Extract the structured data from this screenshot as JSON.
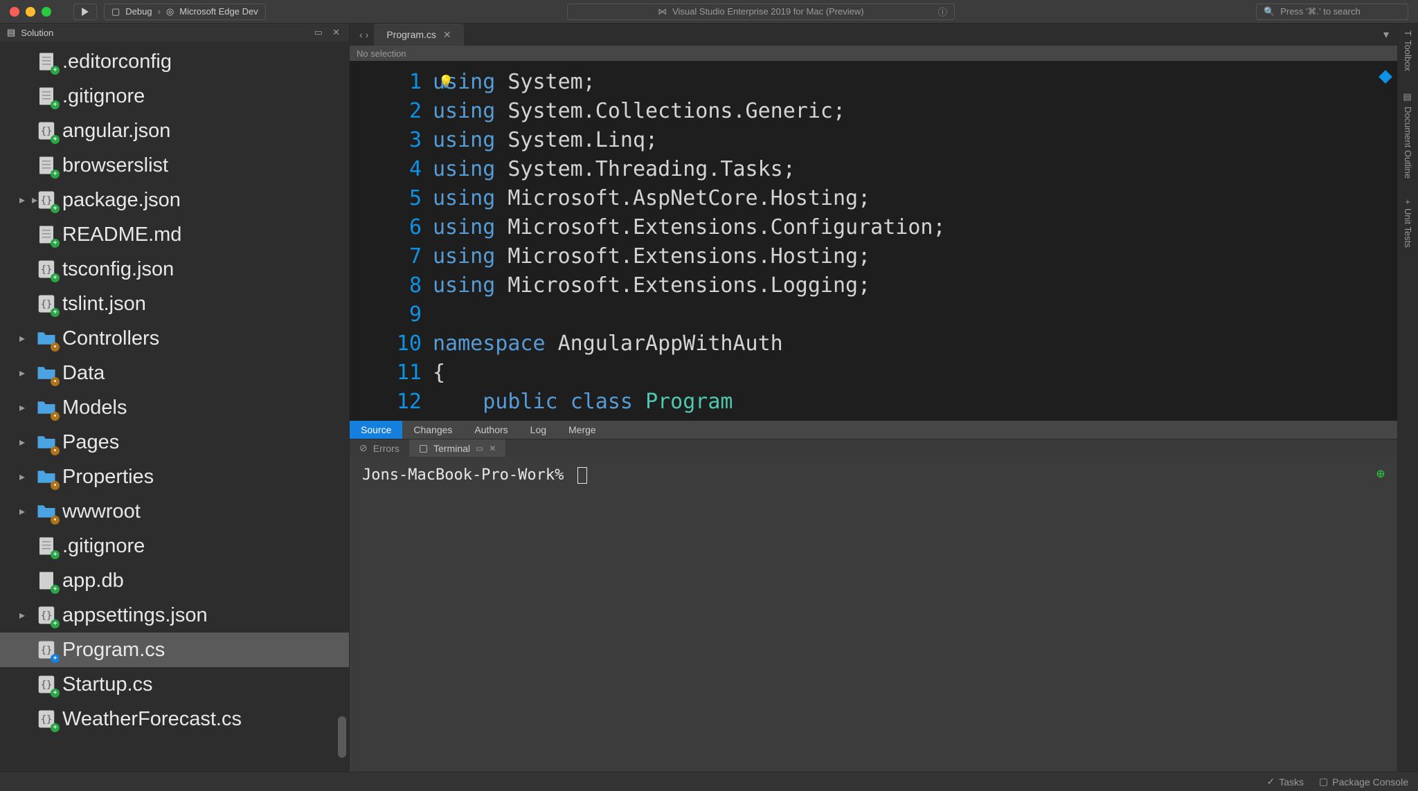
{
  "titlebar": {
    "debug_label": "Debug",
    "target_label": "Microsoft Edge Dev",
    "app_title": "Visual Studio Enterprise 2019 for Mac (Preview)",
    "search_placeholder": "Press '⌘.' to search"
  },
  "solution": {
    "header": "Solution",
    "items": [
      {
        "name": ".editorconfig",
        "icon": "file",
        "badge": "add",
        "expand": false
      },
      {
        "name": ".gitignore",
        "icon": "file",
        "badge": "add",
        "expand": false
      },
      {
        "name": "angular.json",
        "icon": "json",
        "badge": "add",
        "expand": false
      },
      {
        "name": "browserslist",
        "icon": "file",
        "badge": "add",
        "expand": false
      },
      {
        "name": "package.json",
        "icon": "json",
        "badge": "add",
        "expand": true,
        "extra_expand": true
      },
      {
        "name": "README.md",
        "icon": "file",
        "badge": "add",
        "expand": false
      },
      {
        "name": "tsconfig.json",
        "icon": "json",
        "badge": "add",
        "expand": false
      },
      {
        "name": "tslint.json",
        "icon": "json",
        "badge": "add",
        "expand": false
      },
      {
        "name": "Controllers",
        "icon": "folder",
        "badge": "mod",
        "expand": true
      },
      {
        "name": "Data",
        "icon": "folder",
        "badge": "mod",
        "expand": true
      },
      {
        "name": "Models",
        "icon": "folder",
        "badge": "mod",
        "expand": true
      },
      {
        "name": "Pages",
        "icon": "folder",
        "badge": "mod",
        "expand": true
      },
      {
        "name": "Properties",
        "icon": "folder",
        "badge": "mod",
        "expand": true
      },
      {
        "name": "wwwroot",
        "icon": "folder",
        "badge": "mod",
        "expand": true
      },
      {
        "name": ".gitignore",
        "icon": "file",
        "badge": "add",
        "expand": false
      },
      {
        "name": "app.db",
        "icon": "blank",
        "badge": "add",
        "expand": false
      },
      {
        "name": "appsettings.json",
        "icon": "json",
        "badge": "add",
        "expand": true
      },
      {
        "name": "Program.cs",
        "icon": "json",
        "badge": "addblue",
        "expand": false,
        "selected": true
      },
      {
        "name": "Startup.cs",
        "icon": "json",
        "badge": "add",
        "expand": false
      },
      {
        "name": "WeatherForecast.cs",
        "icon": "json",
        "badge": "add",
        "expand": false
      }
    ]
  },
  "editor": {
    "tab_name": "Program.cs",
    "breadcrumb": "No selection",
    "lines": [
      {
        "n": 1,
        "tokens": [
          [
            "kw",
            "using"
          ],
          [
            "ns",
            " System;"
          ]
        ]
      },
      {
        "n": 2,
        "tokens": [
          [
            "kw",
            "using"
          ],
          [
            "ns",
            " System.Collections.Generic;"
          ]
        ]
      },
      {
        "n": 3,
        "tokens": [
          [
            "kw",
            "using"
          ],
          [
            "ns",
            " System.Linq;"
          ]
        ]
      },
      {
        "n": 4,
        "tokens": [
          [
            "kw",
            "using"
          ],
          [
            "ns",
            " System.Threading.Tasks;"
          ]
        ]
      },
      {
        "n": 5,
        "tokens": [
          [
            "kw",
            "using"
          ],
          [
            "ns",
            " Microsoft.AspNetCore.Hosting;"
          ]
        ]
      },
      {
        "n": 6,
        "tokens": [
          [
            "kw",
            "using"
          ],
          [
            "ns",
            " Microsoft.Extensions.Configuration;"
          ]
        ]
      },
      {
        "n": 7,
        "tokens": [
          [
            "kw",
            "using"
          ],
          [
            "ns",
            " Microsoft.Extensions.Hosting;"
          ]
        ]
      },
      {
        "n": 8,
        "tokens": [
          [
            "kw",
            "using"
          ],
          [
            "ns",
            " Microsoft.Extensions.Logging;"
          ]
        ]
      },
      {
        "n": 9,
        "tokens": []
      },
      {
        "n": 10,
        "tokens": [
          [
            "kw",
            "namespace"
          ],
          [
            "ns",
            " AngularAppWithAuth"
          ]
        ]
      },
      {
        "n": 11,
        "tokens": [
          [
            "ns",
            "{"
          ]
        ]
      },
      {
        "n": 12,
        "tokens": [
          [
            "ns",
            "    "
          ],
          [
            "kw",
            "public"
          ],
          [
            "ns",
            " "
          ],
          [
            "kw",
            "class"
          ],
          [
            "ns",
            " "
          ],
          [
            "ty",
            "Program"
          ]
        ]
      }
    ]
  },
  "lower_tabs": [
    "Source",
    "Changes",
    "Authors",
    "Log",
    "Merge"
  ],
  "lower_active": "Source",
  "bottom_subtabs": {
    "errors": "Errors",
    "terminal": "Terminal"
  },
  "terminal": {
    "prompt": "Jons-MacBook-Pro-Work%"
  },
  "statusbar": {
    "tasks": "Tasks",
    "package_console": "Package Console"
  },
  "right_tools": [
    "Toolbox",
    "Document Outline",
    "Unit Tests"
  ]
}
